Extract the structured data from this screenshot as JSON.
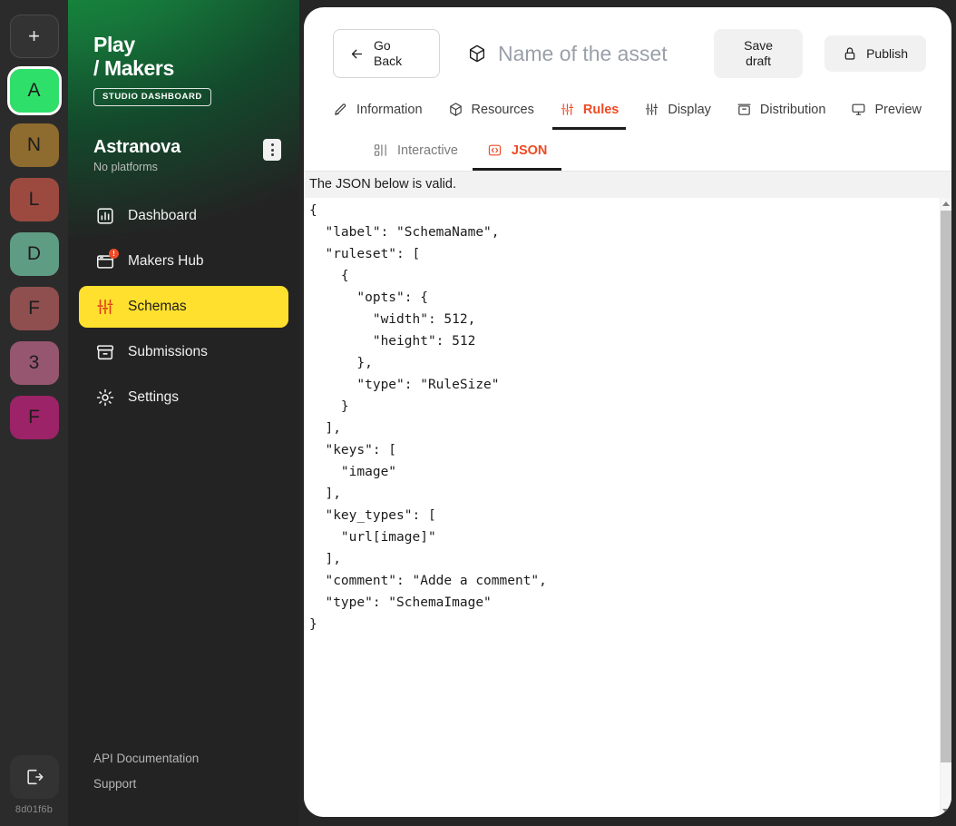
{
  "rail": {
    "add_label": "+",
    "avatars": [
      {
        "letter": "A",
        "color": "#2ee06a",
        "selected": true
      },
      {
        "letter": "N",
        "color": "#8e6b2e",
        "selected": false
      },
      {
        "letter": "L",
        "color": "#9c4a40",
        "selected": false
      },
      {
        "letter": "D",
        "color": "#5f9c84",
        "selected": false
      },
      {
        "letter": "F",
        "color": "#8f4f4f",
        "selected": false
      },
      {
        "letter": "3",
        "color": "#96566f",
        "selected": false
      },
      {
        "letter": "F",
        "color": "#9c2367",
        "selected": false
      }
    ],
    "logout_icon": "logout-icon",
    "version": "8d01f6b"
  },
  "sidebar": {
    "brand_line1": "Play",
    "brand_line2": "/ Makers",
    "brand_badge": "STUDIO DASHBOARD",
    "project_name": "Astranova",
    "project_sub": "No platforms",
    "project_menu_icon": "kebab-menu-icon",
    "nav": [
      {
        "label": "Dashboard",
        "icon": "chart-bars-icon",
        "active": false,
        "badge": ""
      },
      {
        "label": "Makers Hub",
        "icon": "browser-window-icon",
        "active": false,
        "badge": "!"
      },
      {
        "label": "Schemas",
        "icon": "sliders-icon",
        "active": true,
        "badge": ""
      },
      {
        "label": "Submissions",
        "icon": "archive-box-icon",
        "active": false,
        "badge": ""
      },
      {
        "label": "Settings",
        "icon": "gear-icon",
        "active": false,
        "badge": ""
      }
    ],
    "footer_links": [
      "API Documentation",
      "Support"
    ],
    "accent_active": "#ffe02e"
  },
  "header": {
    "go_back_line1": "Go",
    "go_back_line2": "Back",
    "back_arrow_icon": "arrow-left-icon",
    "asset_icon": "cube-icon",
    "asset_placeholder": "Name of the asset",
    "asset_value": "",
    "save_line1": "Save",
    "save_line2": "draft",
    "publish_label": "Publish",
    "publish_icon": "lock-icon"
  },
  "tabs": [
    {
      "label": "Information",
      "icon": "pencil-square-icon",
      "active": false
    },
    {
      "label": "Resources",
      "icon": "cube-icon",
      "active": false
    },
    {
      "label": "Rules",
      "icon": "sliders-icon",
      "active": true
    },
    {
      "label": "Display",
      "icon": "sliders-alt-icon",
      "active": false
    },
    {
      "label": "Distribution",
      "icon": "box-icon",
      "active": false
    },
    {
      "label": "Preview",
      "icon": "monitor-icon",
      "active": false
    }
  ],
  "subtabs": [
    {
      "label": "Interactive",
      "icon": "nodes-icon",
      "active": false
    },
    {
      "label": "JSON",
      "icon": "code-brackets-icon",
      "active": true
    }
  ],
  "editor": {
    "status_text": "The JSON below is valid.",
    "status_bg": "#f2f2f2",
    "json_text": "{\n  \"label\": \"SchemaName\",\n  \"ruleset\": [\n    {\n      \"opts\": {\n        \"width\": 512,\n        \"height\": 512\n      },\n      \"type\": \"RuleSize\"\n    }\n  ],\n  \"keys\": [\n    \"image\"\n  ],\n  \"key_types\": [\n    \"url[image]\"\n  ],\n  \"comment\": \"Adde a comment\",\n  \"type\": \"SchemaImage\"\n}",
    "scrollbar": {
      "up_icon": "scroll-up-arrow-icon",
      "down_icon": "scroll-down-arrow-icon"
    }
  },
  "colors": {
    "accent_red": "#f04a23",
    "accent_yellow": "#ffe02e",
    "brand_green": "#18a03f",
    "dark": "#262626"
  }
}
